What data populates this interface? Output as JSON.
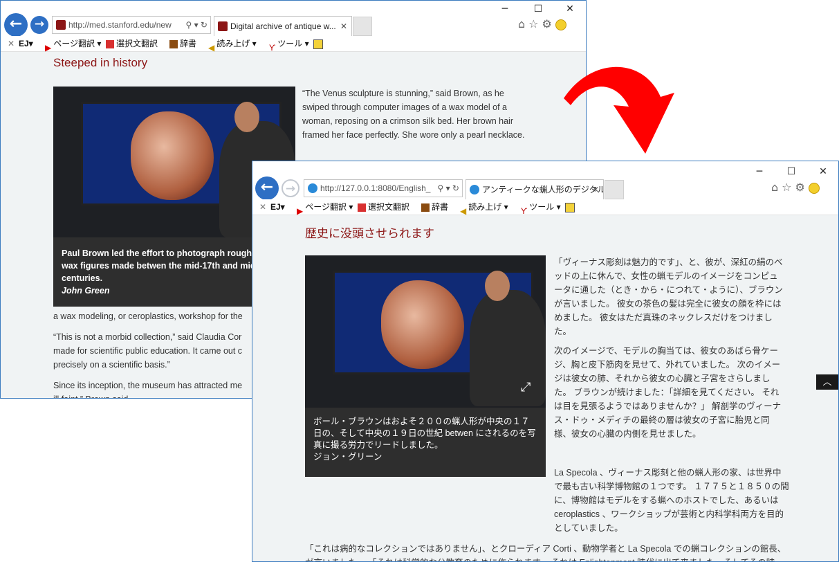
{
  "toolbar": {
    "ej": "EJ▾",
    "page_translate": "ページ翻訳",
    "select_translate": "選択文翻訳",
    "dictionary": "辞書",
    "read_aloud": "読み上げ",
    "tools": "ツール"
  },
  "win1": {
    "url": "http://med.stanford.edu/new",
    "tab_title": "Digital archive of antique w...",
    "heading": "Steeped in history",
    "caption_lines": [
      "Paul Brown led the effort to photograph roughly",
      "wax figures made betwen the mid-17th and mid",
      "centuries."
    ],
    "credit": "John Green",
    "right_paragraph": "“The Venus sculpture is stunning,” said Brown, as he swiped through computer images of a wax model of a woman, reposing on a crimson silk bed. Her brown hair framed her face perfectly. She wore only a pearl necklace.",
    "lines": [
      "a wax modeling, or ceroplastics, workshop for the",
      "“This is not a morbid collection,” said Claudia Cor",
      "made for scientific public education. It came out c",
      "precisely on a scientific basis.”",
      "Since its inception, the museum has attracted me",
      "ill faint,” Brown said."
    ]
  },
  "win2": {
    "url": "http://127.0.0.1:8080/English_",
    "tab_title": "アンティークな蝋人形のデジタル...",
    "heading": "歴史に没頭させられます",
    "caption": "ボール・ブラウンはおよそ２００の蝋人形が中央の１７日の、そして中央の１９日の世紀 betwen にされるのを写真に撮る労力でリードしました。",
    "credit": "ジョン・グリーン",
    "para1": "「ヴィーナス彫刻は魅力的です」、と、彼が、深紅の絹のベッドの上に休んで、女性の蝋モデルのイメージをコンピュータに通した（とき・から・につれて・ように）、ブラウンが言いました。 彼女の茶色の髪は完全に彼女の顔を枠にはめました。 彼女はただ真珠のネックレスだけをつけました。",
    "para2": "次のイメージで、モデルの胸当ては、彼女のあばら骨ケージ、胸と皮下筋肉を見せて、外れていました。 次のイメージは彼女の肺、それから彼女の心臓と子宮をさらしました。 ブラウンが続けました：「詳細を見てください。 それは目を見張るようではありませんか？」 解剖学のヴィーナス・ドゥ・メディチの最終の層は彼女の子宮に胎児と同様、彼女の心臓の内側を見せました。",
    "para3": "La Specola 、ヴィーナス彫刻と他の蝋人形の家、は世界中で最も古い科学博物館の１つです。 １７７５と１８５０の間に、博物館はモデルをする蝋へのホストでした、あるいは ceroplastics 、ワークショップが芸術と内科学科両方を目的としていました。",
    "para4": "「これは病的なコレクションではありません」、とクローディア Corti 、動物学者と La Specola での蝋コレクションの館長、が言いました。 「それは科学的な公教育のために作られます。 それは Enlightenment 時代に出て来ました、そしてその時［芸術家］が正確に科学的根拠に取り組もうとしていました。」"
  },
  "colors": {
    "arrow": "#ff0000",
    "heading": "#8c1515",
    "nav_blue": "#2e6fc4"
  }
}
